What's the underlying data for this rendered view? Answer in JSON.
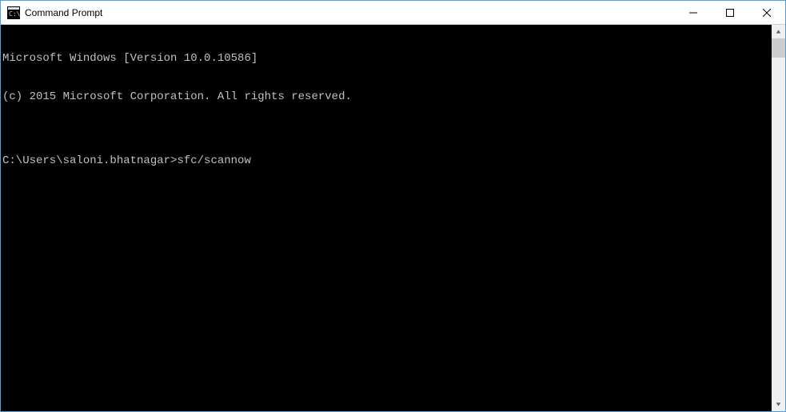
{
  "window": {
    "title": "Command Prompt"
  },
  "terminal": {
    "line1": "Microsoft Windows [Version 10.0.10586]",
    "line2": "(c) 2015 Microsoft Corporation. All rights reserved.",
    "blank": "",
    "prompt": "C:\\Users\\saloni.bhatnagar>",
    "command": "sfc/scannow"
  }
}
